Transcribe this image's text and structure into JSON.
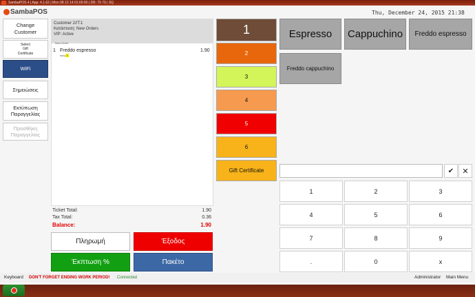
{
  "window": {
    "title": "SambaPOS 4 | App: 4.1.62 | Mon 08 12 14 01:00:00 | DB: 79 79 | SQ"
  },
  "brand": {
    "name": "SambaPOS"
  },
  "header": {
    "datetime": "Thu, December 24, 2015 21:38"
  },
  "left_buttons": [
    {
      "label": "Change\nCustomer"
    },
    {
      "label": "Select\nGift\nCertificate"
    },
    {
      "label": "WiFi"
    },
    {
      "label": "Σημειώσεις"
    },
    {
      "label": "Εκτύπωση\nΠαραγγελίας"
    },
    {
      "label": "Προσθήκη\nΠαραγγελίας"
    }
  ],
  "ticket": {
    "customer": "Customer 2//T:1",
    "status": "Κατάσταση: New Orders",
    "vip": "VIP: Active",
    "new_order_label": "New Order",
    "orders": [
      {
        "qty": "1",
        "name": "Freddo espresso",
        "price": "1.90",
        "tag_prefix": "new,",
        "tag": "Х"
      }
    ],
    "totals": {
      "ticket_total_label": "Ticket Total:",
      "ticket_total": "1.90",
      "tax_total_label": "Tax Total:",
      "tax_total": "0.36",
      "balance_label": "Balance:",
      "balance": "1.90"
    }
  },
  "actions": {
    "payment": "Πληρωμή",
    "exit": "Έξοδος",
    "discount": "Έκπτωση %",
    "package": "Πακέτο"
  },
  "categories": [
    {
      "label": "1",
      "color": "#6e4c38"
    },
    {
      "label": "2",
      "color": "#e8670c"
    },
    {
      "label": "3",
      "color": "#d3f55a"
    },
    {
      "label": "4",
      "color": "#f59a4e"
    },
    {
      "label": "5",
      "color": "#f00000"
    },
    {
      "label": "6",
      "color": "#f7b319"
    },
    {
      "label": "Gift Certificate",
      "color": "#f7b319"
    }
  ],
  "products": [
    {
      "label": "Espresso"
    },
    {
      "label": "Cappuchino"
    },
    {
      "label": "Freddo espresso"
    },
    {
      "label": "Freddo cappuchino"
    }
  ],
  "numpad": {
    "confirm_icon": "check-icon",
    "clear_icon": "close-icon",
    "keys": [
      "1",
      "2",
      "3",
      "4",
      "5",
      "6",
      "7",
      "8",
      "9",
      ".",
      "0",
      "x"
    ]
  },
  "statusbar": {
    "keyboard": "Keyboard",
    "warning": "DON'T FORGET ENDING WORK PERIOD!",
    "connection": "Connected",
    "user": "Administrator",
    "main_menu": "Main Menu"
  },
  "colors": {
    "payment_bg": "#ffffff",
    "exit_bg": "#ee0000",
    "discount_bg": "#12a012",
    "package_bg": "#3d68a6",
    "wifi_bg": "#2b4e88",
    "balance": "#e00000",
    "product_bg": "#a6a6a6"
  }
}
